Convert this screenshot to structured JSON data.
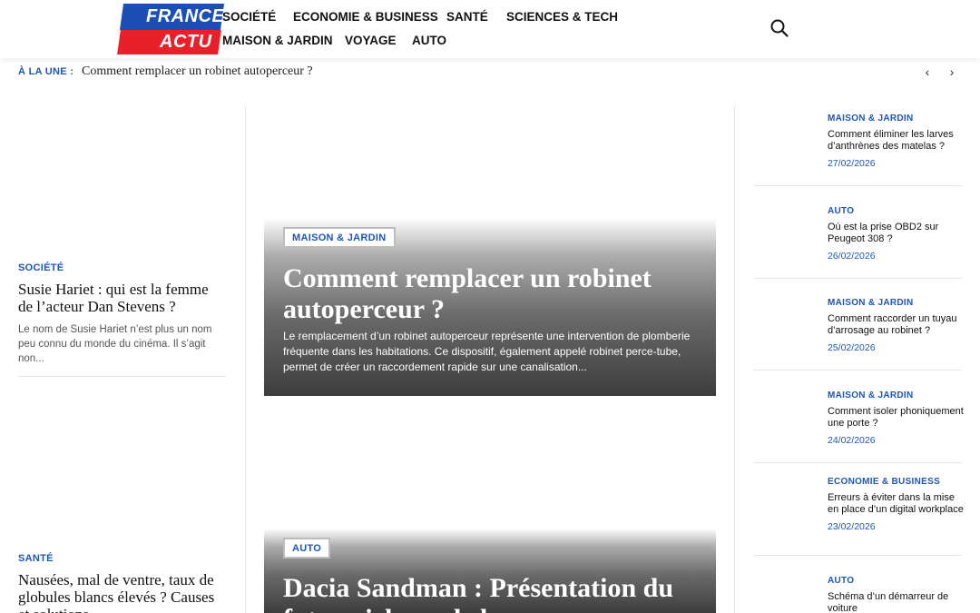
{
  "logo": {
    "line1": "FRANCE",
    "line2": "ACTU",
    "blue": "#1c4fb4",
    "red": "#e8202a"
  },
  "nav": {
    "items": [
      "SOCIÉTÉ",
      "ECONOMIE & BUSINESS",
      "SANTÉ",
      "SCIENCES & TECH",
      "MAISON & JARDIN",
      "VOYAGE",
      "AUTO"
    ]
  },
  "search": {
    "icon": "search-icon"
  },
  "ticker": {
    "label": "À LA UNE :",
    "title": "Comment remplacer un robinet autoperceur ?",
    "prev": "‹",
    "next": "›"
  },
  "left_posts": [
    {
      "category": "SOCIÉTÉ",
      "title": "Susie Hariet : qui est la femme de l’acteur Dan Stevens ?",
      "excerpt": "Le nom de Susie Hariet n’est plus un nom peu connu du monde du cinéma. Il s’agit non..."
    },
    {
      "category": "SANTÉ",
      "title": "Nausées, mal de ventre, taux de globules blancs élevés ? Causes et solutions",
      "excerpt": ""
    }
  ],
  "featured": [
    {
      "category": "MAISON & JARDIN",
      "title": "Comment remplacer un robinet autoperceur ?",
      "excerpt": "Le remplacement d’un robinet autoperceur représente une intervention de plomberie fréquente dans les habitations. Ce dispositif, également appelé robinet perce-tube, permet de créer un raccordement rapide sur une canalisation..."
    },
    {
      "category": "AUTO",
      "title": "Dacia Sandman : Présentation du futur pick-up de la marque",
      "excerpt": ""
    }
  ],
  "right_posts": [
    {
      "category": "MAISON & JARDIN",
      "title": "Comment éliminer les larves d’anthrènes des matelas ?",
      "date": "27/02/2026"
    },
    {
      "category": "AUTO",
      "title": "Où est la prise OBD2 sur Peugeot 308 ?",
      "date": "26/02/2026"
    },
    {
      "category": "MAISON & JARDIN",
      "title": "Comment raccorder un tuyau d’arrosage au robinet ?",
      "date": "25/02/2026"
    },
    {
      "category": "MAISON & JARDIN",
      "title": "Comment isoler phoniquement une porte ?",
      "date": "24/02/2026"
    },
    {
      "category": "ECONOMIE & BUSINESS",
      "title": "Erreurs à éviter dans la mise en place d’un digital workplace",
      "date": "23/02/2026"
    },
    {
      "category": "AUTO",
      "title": "Schéma d’un démarreur de voiture",
      "date": ""
    }
  ],
  "colors": {
    "accent": "#1c56b8",
    "text": "#111111"
  }
}
